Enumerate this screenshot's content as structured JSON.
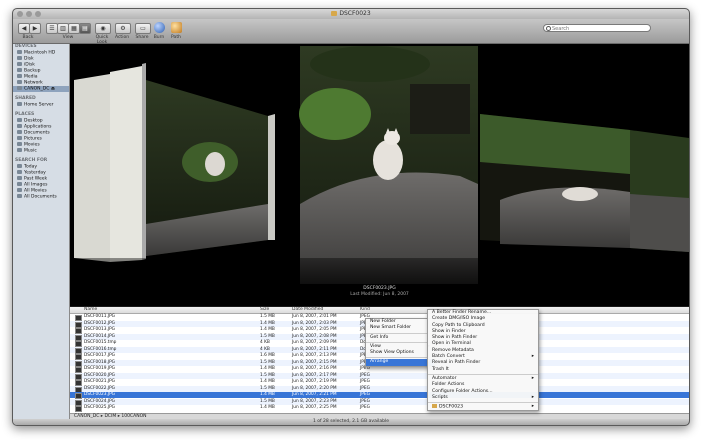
{
  "window": {
    "title": "DSCF0023"
  },
  "toolbar": {
    "back": "◀",
    "forward": "▶",
    "view_modes": [
      "☰",
      "▥",
      "▦",
      "▤"
    ],
    "labels": [
      "Back",
      "View",
      "Quick Look",
      "Action",
      "Share",
      "Burn",
      "Path",
      "Get Info"
    ],
    "search_placeholder": "Search"
  },
  "sidebar": {
    "headers": [
      "DEVICES",
      "SHARED",
      "PLACES",
      "SEARCH FOR"
    ],
    "devices": [
      "Macintosh HD",
      "Disk",
      "iDisk",
      "Backup",
      "Media",
      "Network",
      "CANON_DC"
    ],
    "shared": [
      "Home Server"
    ],
    "places": [
      "Desktop",
      "Applications",
      "Documents",
      "Pictures",
      "Movies",
      "Music"
    ],
    "search_for": [
      "Today",
      "Yesterday",
      "Past Week",
      "All Images",
      "All Movies",
      "All Documents"
    ]
  },
  "coverflow": {
    "filename": "DSCF0023.JPG",
    "subtitle": "Last Modified: Jun 8, 2007"
  },
  "list": {
    "columns": [
      "Name",
      "Size",
      "Date Modified",
      "Kind"
    ],
    "rows": [
      {
        "name": "DSCF0011.JPG",
        "size": "1.5 MB",
        "date": "Jun 8, 2007, 2:01 PM",
        "kind": "JPEG"
      },
      {
        "name": "DSCF0012.JPG",
        "size": "1.4 MB",
        "date": "Jun 8, 2007, 2:03 PM",
        "kind": "JPEG"
      },
      {
        "name": "DSCF0013.JPG",
        "size": "1.4 MB",
        "date": "Jun 8, 2007, 2:05 PM",
        "kind": "JPEG"
      },
      {
        "name": "DSCF0014.JPG",
        "size": "1.5 MB",
        "date": "Jun 8, 2007, 2:08 PM",
        "kind": "JPEG"
      },
      {
        "name": "DSCF0015.tmp",
        "size": "4 KB",
        "date": "Jun 8, 2007, 2:09 PM",
        "kind": "Document"
      },
      {
        "name": "DSCF0016.tmp",
        "size": "4 KB",
        "date": "Jun 8, 2007, 2:11 PM",
        "kind": "Document"
      },
      {
        "name": "DSCF0017.JPG",
        "size": "1.6 MB",
        "date": "Jun 8, 2007, 2:13 PM",
        "kind": "JPEG"
      },
      {
        "name": "DSCF0018.JPG",
        "size": "1.5 MB",
        "date": "Jun 8, 2007, 2:15 PM",
        "kind": "JPEG"
      },
      {
        "name": "DSCF0019.JPG",
        "size": "1.4 MB",
        "date": "Jun 8, 2007, 2:16 PM",
        "kind": "JPEG"
      },
      {
        "name": "DSCF0020.JPG",
        "size": "1.5 MB",
        "date": "Jun 8, 2007, 2:17 PM",
        "kind": "JPEG"
      },
      {
        "name": "DSCF0021.JPG",
        "size": "1.4 MB",
        "date": "Jun 8, 2007, 2:19 PM",
        "kind": "JPEG"
      },
      {
        "name": "DSCF0022.JPG",
        "size": "1.5 MB",
        "date": "Jun 8, 2007, 2:20 PM",
        "kind": "JPEG"
      },
      {
        "name": "DSCF0023.JPG",
        "size": "1.4 MB",
        "date": "Jun 8, 2007, 2:21 PM",
        "kind": "JPEG"
      },
      {
        "name": "DSCF0024.JPG",
        "size": "1.5 MB",
        "date": "Jun 8, 2007, 2:23 PM",
        "kind": "JPEG"
      },
      {
        "name": "DSCF0025.JPG",
        "size": "1.4 MB",
        "date": "Jun 8, 2007, 2:25 PM",
        "kind": "JPEG"
      }
    ]
  },
  "pathbar": "CANON_DC ▸ DCIM ▸ 100CANON",
  "statusbar": "1 of 28 selected, 2.1 GB available",
  "context_menu": {
    "items": [
      "New Folder",
      "New Smart Folder",
      "Get Info",
      "View",
      "Show View Options",
      "Arrange"
    ]
  },
  "submenu": {
    "items": [
      "A Better Finder Rename...",
      "Create DMG/ISO Image",
      "Copy Path to Clipboard",
      "Show in Finder",
      "Show in Path Finder",
      "Open in Terminal",
      "Remove Metadata",
      "Batch Convert",
      "Reveal in Path Finder",
      "Trash It",
      "Automator",
      "Folder Actions",
      "Configure Folder Actions...",
      "Scripts",
      "DSCF0023"
    ]
  }
}
